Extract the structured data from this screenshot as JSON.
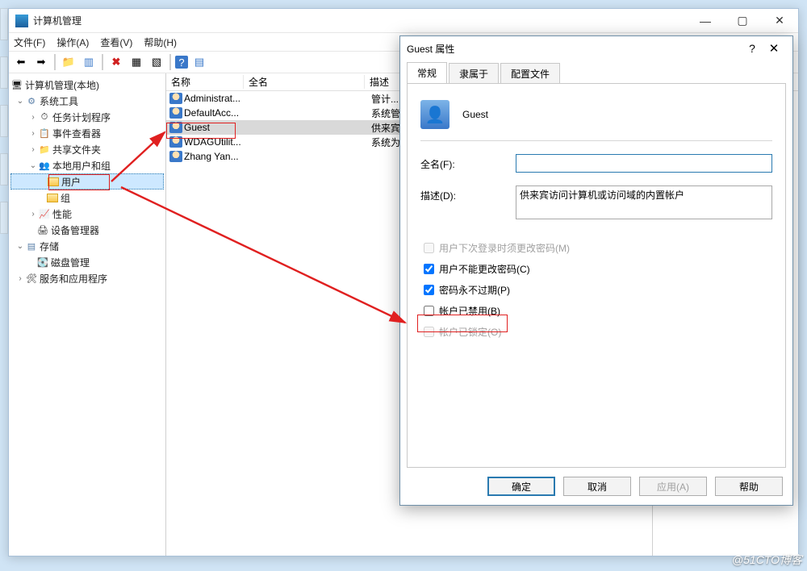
{
  "main": {
    "title": "计算机管理",
    "menus": [
      "文件(F)",
      "操作(A)",
      "查看(V)",
      "帮助(H)"
    ],
    "tree": {
      "root": "计算机管理(本地)",
      "n1": "系统工具",
      "n1a": "任务计划程序",
      "n1b": "事件查看器",
      "n1c": "共享文件夹",
      "n1d": "本地用户和组",
      "n1d1": "用户",
      "n1d2": "组",
      "n1e": "性能",
      "n1f": "设备管理器",
      "n2": "存储",
      "n2a": "磁盘管理",
      "n3": "服务和应用程序"
    },
    "columns": {
      "name": "名称",
      "fullname": "全名",
      "desc": "描述"
    },
    "rows": [
      {
        "name": "Administrat...",
        "desc": "管计..."
      },
      {
        "name": "DefaultAcc...",
        "desc": "系统管..."
      },
      {
        "name": "Guest",
        "desc": "供来宾..."
      },
      {
        "name": "WDAGUtilit...",
        "desc": "系统为..."
      },
      {
        "name": "Zhang Yan...",
        "desc": ""
      }
    ]
  },
  "dialog": {
    "title": "Guest 属性",
    "tabs": {
      "general": "常规",
      "member": "隶属于",
      "profile": "配置文件"
    },
    "account_name": "Guest",
    "fullname_label": "全名(F):",
    "fullname_value": "",
    "desc_label": "描述(D):",
    "desc_value": "供来宾访问计算机或访问域的内置帐户",
    "chk_mustchange": "用户下次登录时须更改密码(M)",
    "chk_cannotchange": "用户不能更改密码(C)",
    "chk_neverexpire": "密码永不过期(P)",
    "chk_disabled": "帐户已禁用(B)",
    "chk_locked": "帐户已锁定(O)",
    "btn_ok": "确定",
    "btn_cancel": "取消",
    "btn_apply": "应用(A)",
    "btn_help": "帮助"
  },
  "watermark": "@51CTO博客"
}
